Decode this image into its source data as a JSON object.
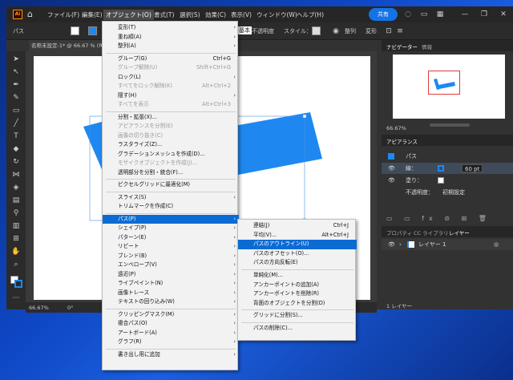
{
  "app": {
    "logo": "Ai",
    "menus": [
      "ファイル(F)",
      "編集(E)",
      "オブジェクト(O)",
      "書式(T)",
      "選択(S)",
      "効果(C)",
      "表示(V)",
      "ウィンドウ(W)",
      "ヘルプ(H)"
    ],
    "share_label": "共有",
    "doc_tab": "名称未設定-1* @ 66.67 % (RGB/",
    "control_bar": {
      "left_label": "パス",
      "right_stroke_label": "基本",
      "opacity_label": "不透明度",
      "style_label": "スタイル：",
      "align_label": "整列",
      "transform_label": "変形"
    },
    "status": {
      "zoom": "66.67%",
      "angle": "0°"
    }
  },
  "object_menu": {
    "items": [
      {
        "label": "変形(T)",
        "shortcut": "",
        "arrow": true,
        "disabled": false
      },
      {
        "label": "重ね順(A)",
        "shortcut": "",
        "arrow": true,
        "disabled": false
      },
      {
        "label": "整列(A)",
        "shortcut": "",
        "arrow": true,
        "disabled": false
      },
      {
        "sep": true
      },
      {
        "label": "グループ(G)",
        "shortcut": "Ctrl+G",
        "arrow": false,
        "disabled": false
      },
      {
        "label": "グループ解除(U)",
        "shortcut": "Shift+Ctrl+G",
        "arrow": false,
        "disabled": true
      },
      {
        "label": "ロック(L)",
        "shortcut": "",
        "arrow": true,
        "disabled": false
      },
      {
        "label": "すべてをロック解除(K)",
        "shortcut": "Alt+Ctrl+2",
        "arrow": false,
        "disabled": true
      },
      {
        "label": "隠す(H)",
        "shortcut": "",
        "arrow": true,
        "disabled": false
      },
      {
        "label": "すべてを表示",
        "shortcut": "Alt+Ctrl+3",
        "arrow": false,
        "disabled": true
      },
      {
        "sep": true
      },
      {
        "label": "分割・拡張(X)...",
        "shortcut": "",
        "arrow": false,
        "disabled": false
      },
      {
        "label": "アピアランスを分割(E)",
        "shortcut": "",
        "arrow": false,
        "disabled": true
      },
      {
        "label": "画像の切り抜き(C)",
        "shortcut": "",
        "arrow": false,
        "disabled": true
      },
      {
        "label": "ラスタライズ(Z)...",
        "shortcut": "",
        "arrow": false,
        "disabled": false
      },
      {
        "label": "グラデーションメッシュを作成(D)...",
        "shortcut": "",
        "arrow": false,
        "disabled": false
      },
      {
        "label": "モザイクオブジェクトを作成(J)...",
        "shortcut": "",
        "arrow": false,
        "disabled": true
      },
      {
        "label": "透明部分を分割・統合(F)...",
        "shortcut": "",
        "arrow": false,
        "disabled": false
      },
      {
        "sep": true
      },
      {
        "label": "ピクセルグリッドに最適化(M)",
        "shortcut": "",
        "arrow": false,
        "disabled": false
      },
      {
        "sep": true
      },
      {
        "label": "スライス(S)",
        "shortcut": "",
        "arrow": true,
        "disabled": false
      },
      {
        "label": "トリムマークを作成(C)",
        "shortcut": "",
        "arrow": false,
        "disabled": false
      },
      {
        "sep": true
      },
      {
        "label": "パス(P)",
        "shortcut": "",
        "arrow": true,
        "disabled": false,
        "highlight": true
      },
      {
        "label": "シェイプ(P)",
        "shortcut": "",
        "arrow": true,
        "disabled": false
      },
      {
        "label": "パターン(E)",
        "shortcut": "",
        "arrow": true,
        "disabled": false
      },
      {
        "label": "リピート",
        "shortcut": "",
        "arrow": true,
        "disabled": false
      },
      {
        "label": "ブレンド(B)",
        "shortcut": "",
        "arrow": true,
        "disabled": false
      },
      {
        "label": "エンベロープ(V)",
        "shortcut": "",
        "arrow": true,
        "disabled": false
      },
      {
        "label": "遠近(P)",
        "shortcut": "",
        "arrow": true,
        "disabled": false
      },
      {
        "label": "ライブペイント(N)",
        "shortcut": "",
        "arrow": true,
        "disabled": false
      },
      {
        "label": "画像トレース",
        "shortcut": "",
        "arrow": true,
        "disabled": false
      },
      {
        "label": "テキストの回り込み(W)",
        "shortcut": "",
        "arrow": true,
        "disabled": false
      },
      {
        "sep": true
      },
      {
        "label": "クリッピングマスク(M)",
        "shortcut": "",
        "arrow": true,
        "disabled": false
      },
      {
        "label": "複合パス(O)",
        "shortcut": "",
        "arrow": true,
        "disabled": false
      },
      {
        "label": "アートボード(A)",
        "shortcut": "",
        "arrow": true,
        "disabled": false
      },
      {
        "label": "グラフ(R)",
        "shortcut": "",
        "arrow": true,
        "disabled": false
      },
      {
        "sep": true
      },
      {
        "label": "書き出し用に追加",
        "shortcut": "",
        "arrow": true,
        "disabled": false
      }
    ]
  },
  "path_submenu": {
    "items": [
      {
        "label": "連結(J)",
        "shortcut": "Ctrl+J"
      },
      {
        "label": "平均(V)...",
        "shortcut": "Alt+Ctrl+J"
      },
      {
        "label": "パスのアウトライン(U)",
        "shortcut": "",
        "highlight": true
      },
      {
        "label": "パスのオフセット(O)...",
        "shortcut": ""
      },
      {
        "label": "パスの方向反転(E)",
        "shortcut": ""
      },
      {
        "sep": true
      },
      {
        "label": "単純化(M)...",
        "shortcut": ""
      },
      {
        "label": "アンカーポイントの追加(A)",
        "shortcut": ""
      },
      {
        "label": "アンカーポイントを削除(R)",
        "shortcut": ""
      },
      {
        "label": "背面のオブジェクトを分割(D)",
        "shortcut": ""
      },
      {
        "sep": true
      },
      {
        "label": "グリッドに分割(S)...",
        "shortcut": ""
      },
      {
        "sep": true
      },
      {
        "label": "パスの削除(C)...",
        "shortcut": ""
      }
    ]
  },
  "panels": {
    "navigator_tabs": [
      "ナビゲーター",
      "情報"
    ],
    "navigator_zoom": "66.67%",
    "appearance_tab": "アピアランス",
    "appearance_title": "パス",
    "stroke_label": "線：",
    "stroke_value": "60 pt",
    "fill_label": "塗り：",
    "opacity_label": "不透明度：",
    "opacity_value": "初期設定",
    "layers_tabs": [
      "プロパティ",
      "CC ライブラリ",
      "レイヤー"
    ],
    "layer_name": "レイヤー 1",
    "layer_count": "1 レイヤー"
  },
  "colors": {
    "accent": "#1473e6",
    "shape_blue": "#1e88f0",
    "menu_highlight": "#0b6bd3"
  }
}
